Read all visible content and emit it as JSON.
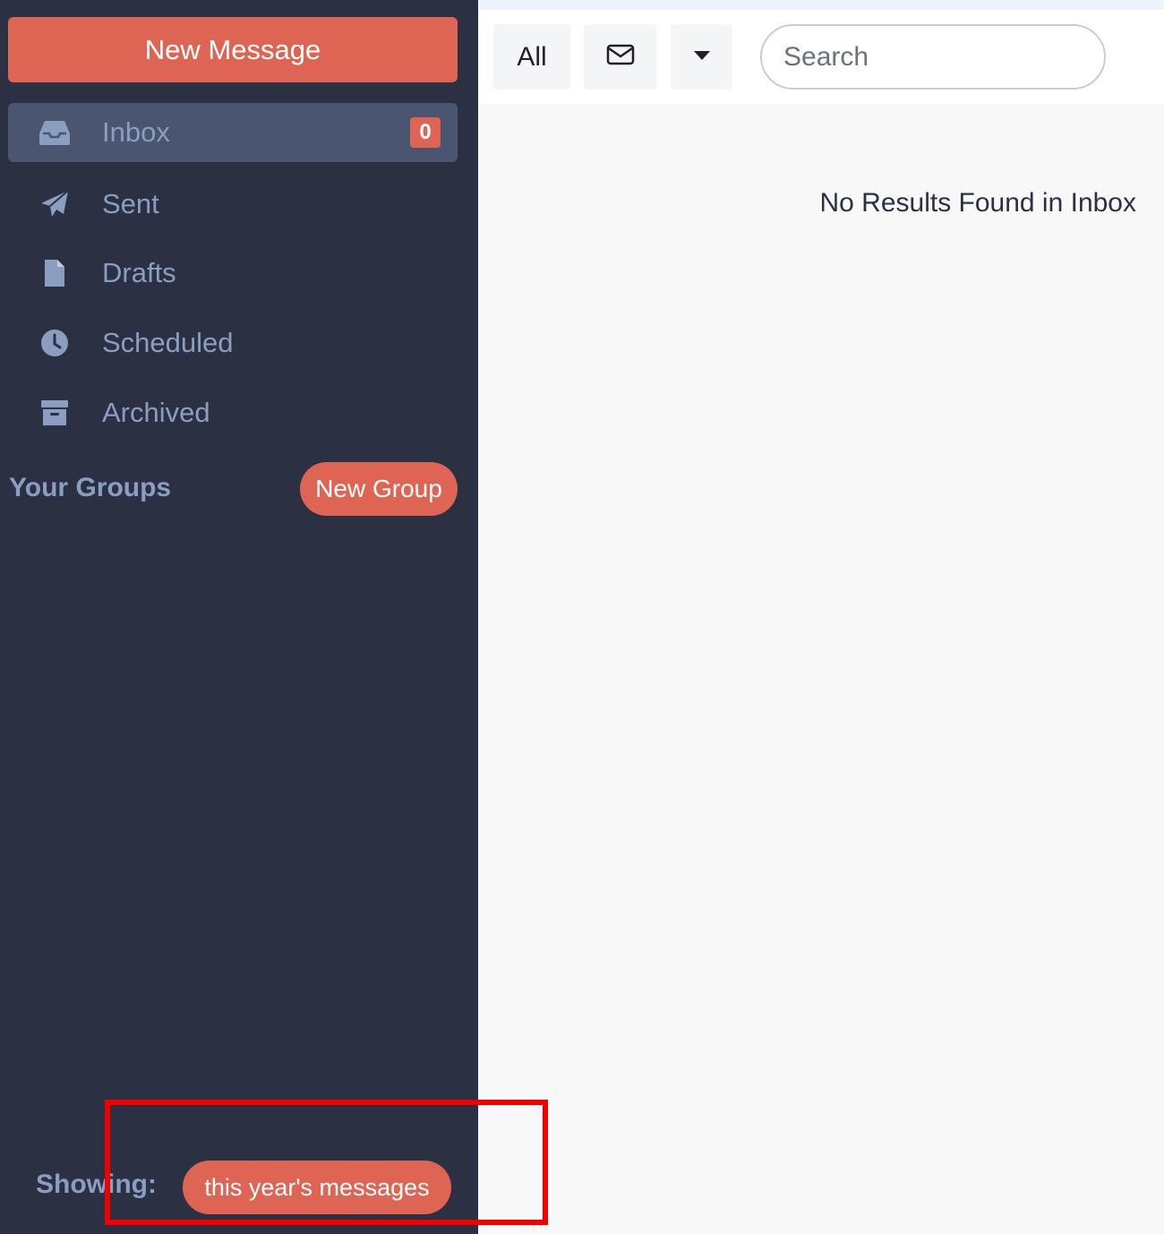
{
  "sidebar": {
    "new_message_label": "New Message",
    "items": [
      {
        "label": "Inbox",
        "icon": "inbox-icon",
        "badge": "0",
        "active": true
      },
      {
        "label": "Sent",
        "icon": "paper-plane-icon"
      },
      {
        "label": "Drafts",
        "icon": "file-icon"
      },
      {
        "label": "Scheduled",
        "icon": "clock-icon"
      },
      {
        "label": "Archived",
        "icon": "archive-icon"
      }
    ],
    "groups_title": "Your Groups",
    "new_group_label": "New Group",
    "showing_label": "Showing:",
    "showing_value": "this year's messages"
  },
  "toolbar": {
    "all_label": "All",
    "mail_icon": "envelope-icon",
    "caret_icon": "caret-down-icon",
    "search_placeholder": "Search"
  },
  "main": {
    "empty_message": "No Results Found in Inbox"
  },
  "colors": {
    "sidebar_bg": "#2b3042",
    "accent": "#de6554",
    "active_item_bg": "#4a5670",
    "muted_text": "#8b9ec0",
    "highlight": "#f20000"
  }
}
